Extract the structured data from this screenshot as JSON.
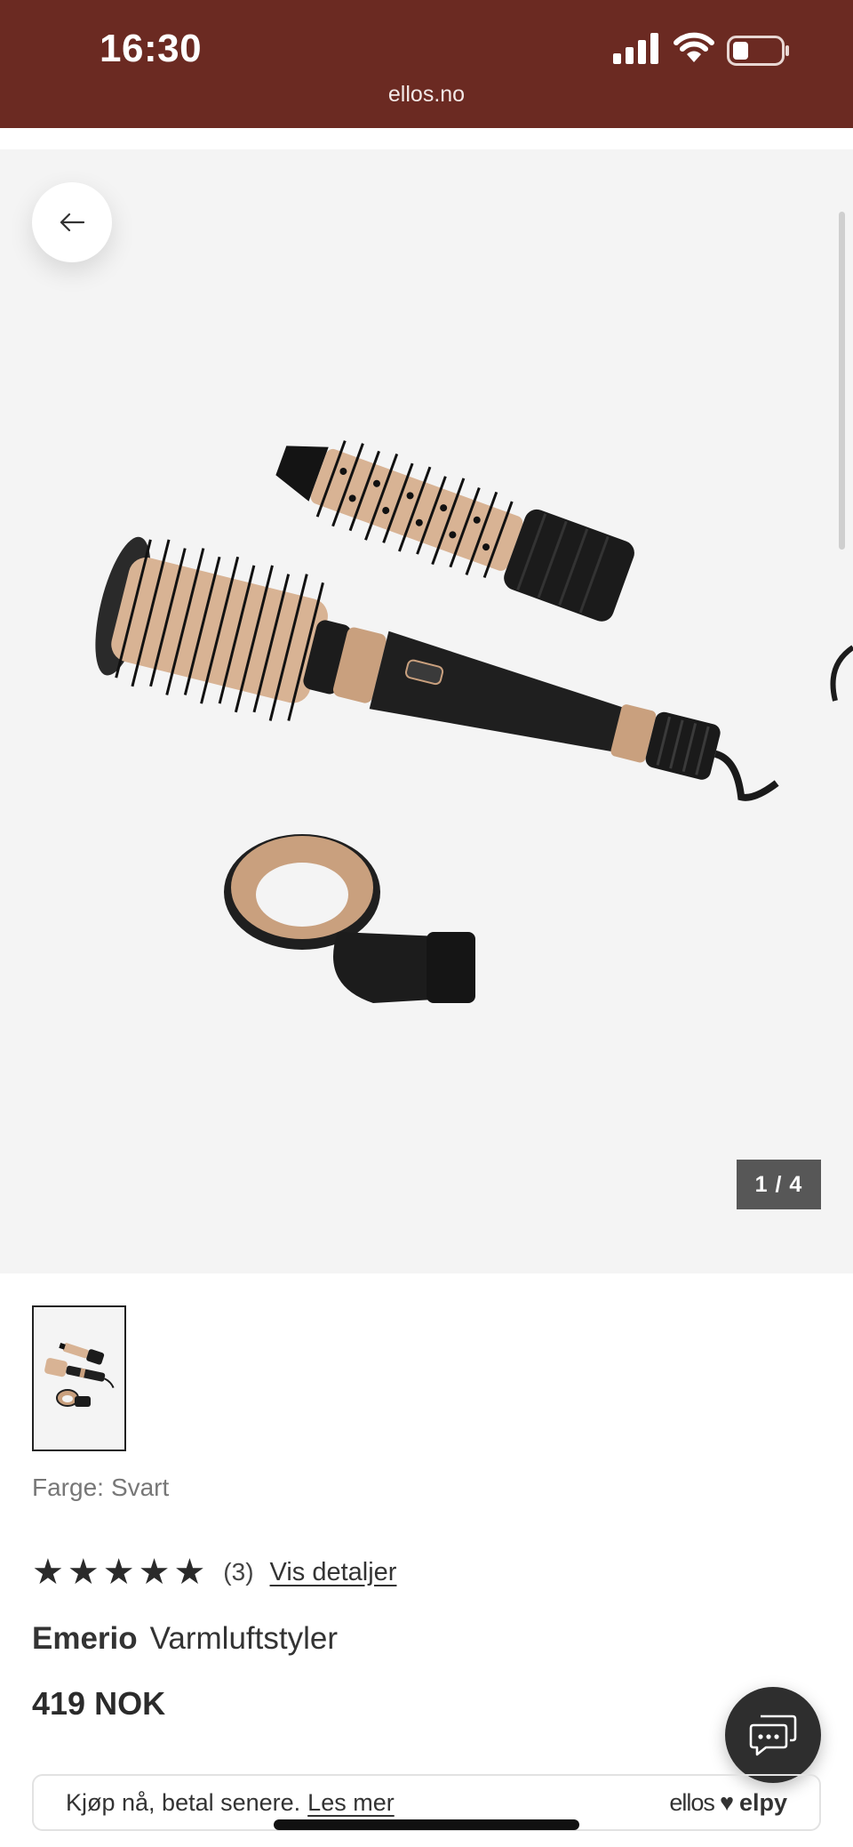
{
  "status_bar": {
    "time": "16:30",
    "url": "ellos.no",
    "background": "#6b2a22"
  },
  "gallery": {
    "counter": "1 / 4",
    "background": "#f4f4f4"
  },
  "product": {
    "color_label": "Farge:",
    "color_value": "Svart",
    "rating_stars": 5,
    "review_count": "(3)",
    "details_link": "Vis detaljer",
    "brand": "Emerio",
    "name": "Varmluftstyler",
    "price": "419 NOK"
  },
  "bnpl": {
    "text": "Kjøp nå, betal senere.",
    "link": "Les mer",
    "logo_left": "ellos",
    "logo_heart": "♥",
    "logo_right": "elpy"
  },
  "icons": {
    "back": "arrow-left-icon",
    "chat": "chat-bubble-icon",
    "star": "star-icon"
  }
}
